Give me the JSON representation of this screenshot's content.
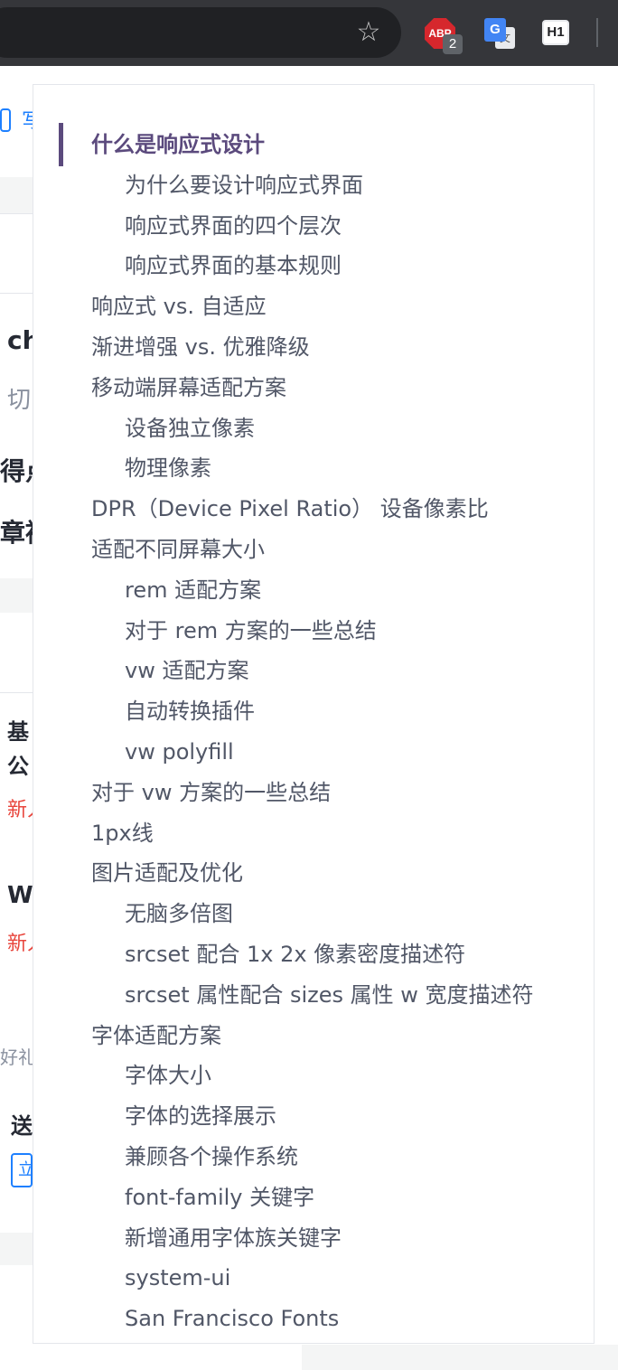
{
  "toolbar": {
    "bookmark_icon": "star-icon",
    "extensions": {
      "abp_label": "ABP",
      "abp_badge": "2",
      "translate_g": "G",
      "translate_t": "文",
      "h1_label": "H1"
    }
  },
  "background": {
    "link_text": "写",
    "frag1": "ch",
    "frag2": "切",
    "frag3": "得点",
    "frag4": "章被",
    "frag5": "基",
    "frag6": "公",
    "frag7": "新人",
    "frag8": "We",
    "frag9": "新人",
    "frag10": "好礼",
    "frag11": "送",
    "button": "立"
  },
  "toc": {
    "items": [
      {
        "label": "什么是响应式设计",
        "level": 1,
        "active": true
      },
      {
        "label": "为什么要设计响应式界面",
        "level": 2
      },
      {
        "label": "响应式界面的四个层次",
        "level": 2
      },
      {
        "label": "响应式界面的基本规则",
        "level": 2
      },
      {
        "label": "响应式 vs. 自适应",
        "level": 1
      },
      {
        "label": "渐进增强 vs. 优雅降级",
        "level": 1
      },
      {
        "label": "移动端屏幕适配方案",
        "level": 1
      },
      {
        "label": "设备独立像素",
        "level": 2
      },
      {
        "label": "物理像素",
        "level": 2
      },
      {
        "label": "DPR（Device Pixel Ratio） 设备像素比",
        "level": 1
      },
      {
        "label": "适配不同屏幕大小",
        "level": 1
      },
      {
        "label": "rem 适配方案",
        "level": 2
      },
      {
        "label": "对于 rem 方案的一些总结",
        "level": 2
      },
      {
        "label": "vw 适配方案",
        "level": 2
      },
      {
        "label": "自动转换插件",
        "level": 2
      },
      {
        "label": "vw polyfill",
        "level": 2
      },
      {
        "label": "对于 vw 方案的一些总结",
        "level": 1
      },
      {
        "label": "1px线",
        "level": 1
      },
      {
        "label": "图片适配及优化",
        "level": 1
      },
      {
        "label": "无脑多倍图",
        "level": 2
      },
      {
        "label": "srcset 配合 1x 2x 像素密度描述符",
        "level": 2
      },
      {
        "label": "srcset 属性配合 sizes 属性 w 宽度描述符",
        "level": 2
      },
      {
        "label": "字体适配方案",
        "level": 1
      },
      {
        "label": "字体大小",
        "level": 2
      },
      {
        "label": "字体的选择展示",
        "level": 2
      },
      {
        "label": "兼顾各个操作系统",
        "level": 2
      },
      {
        "label": "font-family 关键字",
        "level": 2
      },
      {
        "label": "新增通用字体族关键字",
        "level": 2
      },
      {
        "label": "system-ui",
        "level": 2
      },
      {
        "label": "San Francisco Fonts",
        "level": 2
      }
    ]
  },
  "colors": {
    "active": "#5b4a7d",
    "text": "#515767",
    "toolbar_bg": "#35363a"
  }
}
